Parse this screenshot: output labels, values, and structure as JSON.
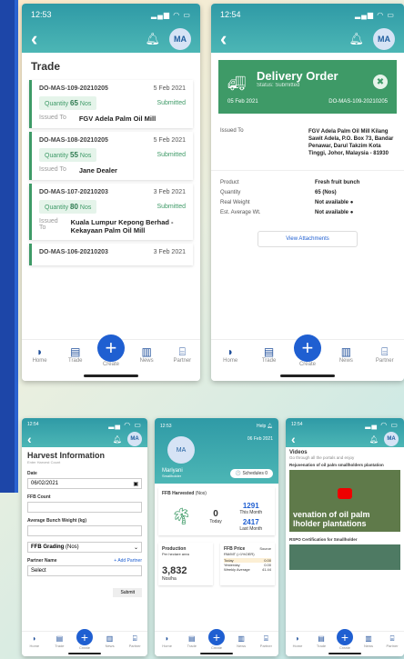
{
  "trade_screen": {
    "time": "12:53",
    "avatar": "MA",
    "title": "Trade",
    "cards": [
      {
        "id": "DO-MAS-109-20210205",
        "date": "5 Feb 2021",
        "qty_label": "Quantity",
        "qty": "65",
        "unit": "Nos",
        "status": "Submitted",
        "issued_label": "Issued To",
        "issued_to": "FGV Adela Palm Oil Mill"
      },
      {
        "id": "DO-MAS-108-20210205",
        "date": "5 Feb 2021",
        "qty_label": "Quantity",
        "qty": "55",
        "unit": "Nos",
        "status": "Submitted",
        "issued_label": "Issued To",
        "issued_to": "Jane Dealer"
      },
      {
        "id": "DO-MAS-107-20210203",
        "date": "3 Feb 2021",
        "qty_label": "Quantity",
        "qty": "80",
        "unit": "Nos",
        "status": "Submitted",
        "issued_label": "Issued To",
        "issued_to": "Kuala Lumpur Kepong Berhad - Kekayaan Palm Oil Mill"
      },
      {
        "id": "DO-MAS-106-20210203",
        "date": "3 Feb 2021"
      }
    ]
  },
  "tabs": [
    "Home",
    "Trade",
    "Create",
    "News",
    "Partner"
  ],
  "delivery_screen": {
    "time": "12:54",
    "avatar": "MA",
    "title": "Delivery Order",
    "status": "Status: Submitted",
    "date": "05 Feb 2021",
    "do_number": "DO-MAS-109-20210205",
    "issued_label": "Issued To",
    "issued_to": "FGV Adela Palm Oil Mill Kilang Sawit Adela, P.O. Box 73, Bandar Penawar, Darul Takzim Kota Tinggi, Johor, Malaysia - 81930",
    "details": [
      {
        "label": "Product",
        "value": "Fresh fruit bunch"
      },
      {
        "label": "Quantity",
        "value": "65 (Nos)"
      },
      {
        "label": "Real Weight",
        "value": "Not available"
      },
      {
        "label": "Est. Average Wt.",
        "value": "Not available"
      }
    ],
    "attach_label": "View Attachments"
  },
  "harvest_screen": {
    "time": "12:54",
    "avatar": "MA",
    "title": "Harvest Information",
    "subtitle": "Enter Harvest Count",
    "date_label": "Date",
    "date_value": "06/02/2021",
    "ffb_count_label": "FFB Count",
    "abw_label": "Average Bunch Weight",
    "abw_unit": "(kg)",
    "grading_label": "FFB Grading",
    "grading_value": "(Nos)",
    "partner_label": "Partner Name",
    "add_partner": "+ Add Partner",
    "partner_value": "Select",
    "submit": "Submit"
  },
  "home_screen": {
    "time": "12:53",
    "help": "Help",
    "date": "06 Feb 2021",
    "avatar": "MA",
    "name": "Mariyani",
    "role": "Smallholder",
    "schedules": "Schedules",
    "schedules_count": "0",
    "ffb_title": "FFB Harvested",
    "ffb_unit": "(Nos)",
    "today_value": "0",
    "today_label": "Today",
    "month_value": "1291",
    "month_label": "This Month",
    "last_month_value": "2417",
    "last_month_label": "Last Month",
    "production_title": "Production",
    "production_sub": "Per hectare area",
    "production_value": "3,832",
    "production_unit": "Nos/ha",
    "price_title": "FFB Price",
    "price_unit": "RM/MT (>1%OER)",
    "price_source": "Source",
    "price_rows": [
      {
        "label": "Today",
        "value": "0.00"
      },
      {
        "label": "Yesterday",
        "value": "0.00"
      },
      {
        "label": "Weekly Average",
        "value": "41.44"
      }
    ]
  },
  "videos_screen": {
    "time": "12:54",
    "avatar": "MA",
    "title": "Videos",
    "subtitle": "Go through all the portals and enjoy",
    "video1_title": "Rejuvenation of oil palm smallholders plantation",
    "video1_overlay": "venation of oil palm lholder plantations",
    "video2_title": "RSPO Certification for Smallholder"
  }
}
